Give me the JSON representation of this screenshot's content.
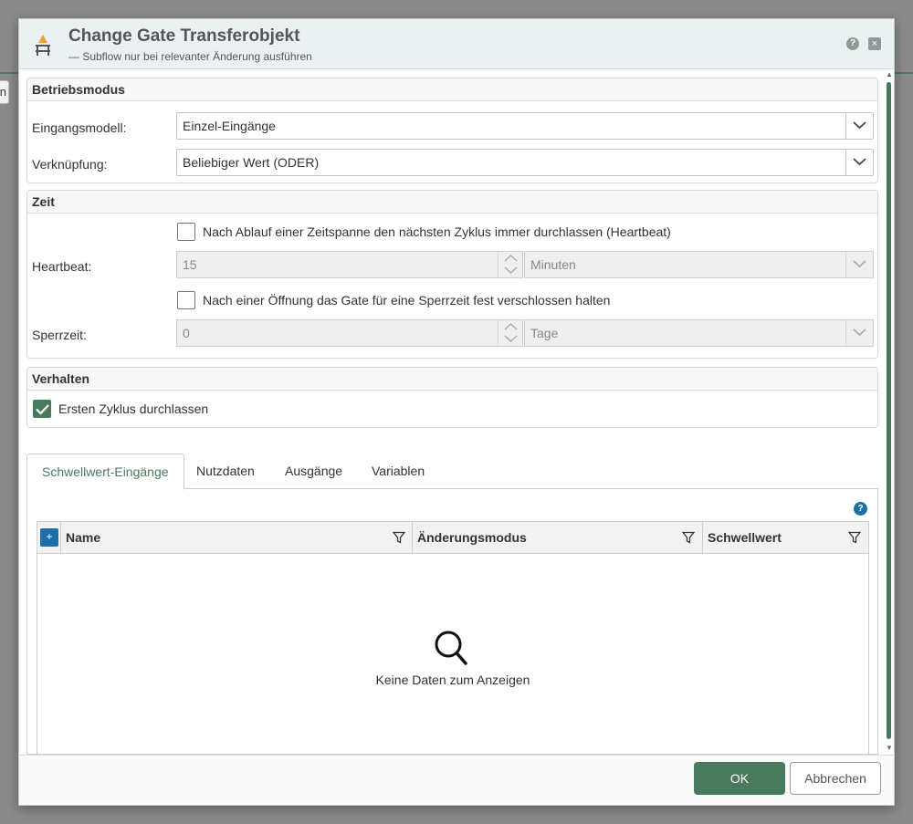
{
  "background": {
    "partial_button_label": "n"
  },
  "dialog": {
    "title": "Change Gate Transferobjekt",
    "subtitle": "— Subflow nur bei relevanter Änderung ausführen",
    "help_icon": "?",
    "close_icon": "×"
  },
  "betriebsmodus": {
    "heading": "Betriebsmodus",
    "eingangsmodell_label": "Eingangsmodell:",
    "eingangsmodell_value": "Einzel-Eingänge",
    "verknuepfung_label": "Verknüpfung:",
    "verknuepfung_value": "Beliebiger Wert (ODER)"
  },
  "zeit": {
    "heading": "Zeit",
    "heartbeat_checkbox_label": "Nach Ablauf einer Zeitspanne den nächsten Zyklus immer durchlassen (Heartbeat)",
    "heartbeat_checked": false,
    "heartbeat_label": "Heartbeat:",
    "heartbeat_value": "15",
    "heartbeat_unit": "Minuten",
    "sperrzeit_checkbox_label": "Nach einer Öffnung das Gate für eine Sperrzeit fest verschlossen halten",
    "sperrzeit_checked": false,
    "sperrzeit_label": "Sperrzeit:",
    "sperrzeit_value": "0",
    "sperrzeit_unit": "Tage"
  },
  "verhalten": {
    "heading": "Verhalten",
    "ersten_zyklus_label": "Ersten Zyklus durchlassen",
    "ersten_zyklus_checked": true
  },
  "tabs": [
    {
      "label": "Schwellwert-Eingänge",
      "active": true
    },
    {
      "label": "Nutzdaten",
      "active": false
    },
    {
      "label": "Ausgänge",
      "active": false
    },
    {
      "label": "Variablen",
      "active": false
    }
  ],
  "grid": {
    "help_icon": "?",
    "add_label": "+",
    "columns": [
      "Name",
      "Änderungsmodus",
      "Schwellwert"
    ],
    "rows": [],
    "empty_text": "Keine Daten zum Anzeigen"
  },
  "footer": {
    "ok_label": "OK",
    "cancel_label": "Abbrechen"
  },
  "colors": {
    "accent_green": "#4a7a5e",
    "accent_blue": "#1d6fa5",
    "header_bg": "#ebf1f3",
    "icon_orange": "#f0a030"
  }
}
